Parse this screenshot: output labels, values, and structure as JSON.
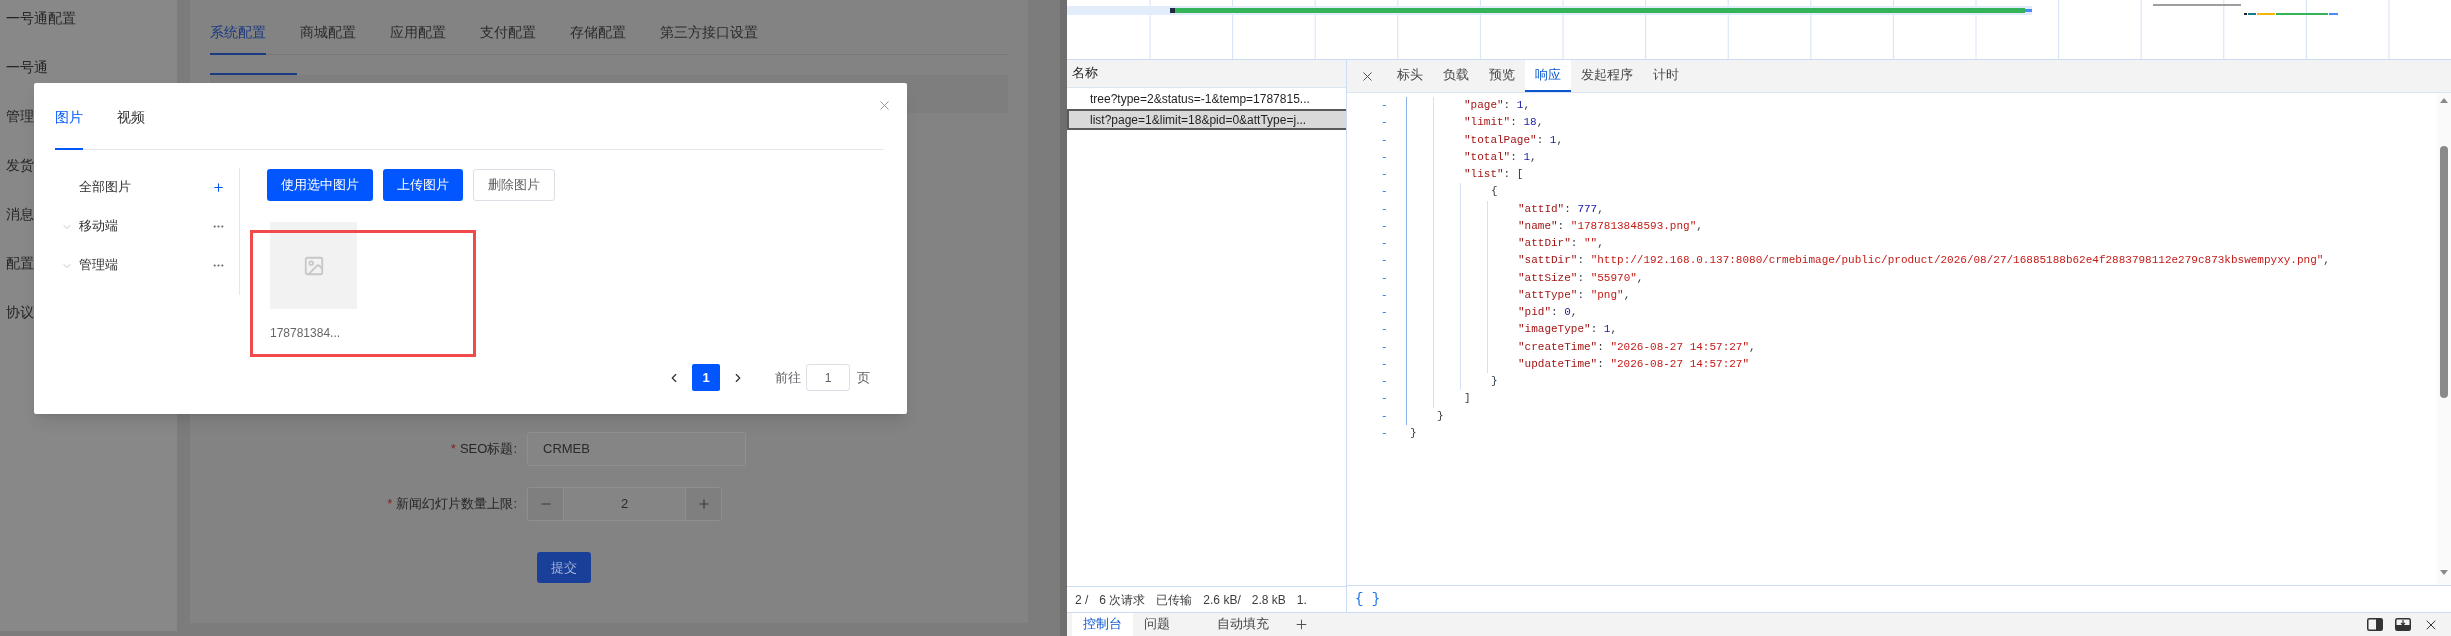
{
  "app": {
    "sidebar": [
      {
        "label": "一号通配置"
      },
      {
        "label": "一号通"
      },
      {
        "label": "管理"
      },
      {
        "label": "发货"
      },
      {
        "label": "消息"
      },
      {
        "label": "配置"
      },
      {
        "label": "协议"
      }
    ],
    "tabs": [
      {
        "label": "系统配置",
        "selected": true
      },
      {
        "label": "商城配置",
        "selected": false
      },
      {
        "label": "应用配置",
        "selected": false
      },
      {
        "label": "支付配置",
        "selected": false
      },
      {
        "label": "存储配置",
        "selected": false
      },
      {
        "label": "第三方接口设置",
        "selected": false
      }
    ],
    "form": {
      "fields": [
        {
          "kind": "text",
          "mark": "*",
          "label": "SEO标题:",
          "value": "CRMEB"
        },
        {
          "kind": "stepper",
          "mark": "*",
          "label": "新闻幻灯片数量上限:",
          "value": "2"
        }
      ],
      "submit": "提交"
    }
  },
  "modal": {
    "tabs": [
      {
        "label": "图片",
        "selected": true
      },
      {
        "label": "视频",
        "selected": false
      }
    ],
    "folders": [
      {
        "kind": "root",
        "label": "全部图片"
      },
      {
        "kind": "group",
        "label": "移动端"
      },
      {
        "kind": "group",
        "label": "管理端"
      }
    ],
    "buttons": [
      {
        "kind": "primary",
        "label": "使用选中图片"
      },
      {
        "kind": "primary",
        "label": "上传图片"
      },
      {
        "kind": "plain",
        "label": "删除图片"
      }
    ],
    "images": [
      {
        "name": "178781384...",
        "highlighted": true
      }
    ],
    "pagination": {
      "pages": [
        {
          "label": "1",
          "selected": true
        }
      ],
      "goto_label": "前往",
      "goto_value": "1",
      "suffix": "页"
    }
  },
  "devtools": {
    "requests": {
      "header": "名称",
      "rows": [
        {
          "name": "tree?type=2&status=-1&temp=1787815...",
          "selected": false
        },
        {
          "name": "list?page=1&limit=18&pid=0&attType=j...",
          "selected": true
        }
      ],
      "status": [
        "2 /",
        "6 次请求",
        "已传输",
        "2.6 kB/",
        "2.8 kB",
        "1."
      ]
    },
    "detail_tabs": [
      {
        "label": "标头",
        "selected": false
      },
      {
        "label": "负载",
        "selected": false
      },
      {
        "label": "预览",
        "selected": false
      },
      {
        "label": "响应",
        "selected": true
      },
      {
        "label": "发起程序",
        "selected": false
      },
      {
        "label": "计时",
        "selected": false
      }
    ],
    "response_lines": [
      {
        "children": [
          {
            "children": [
              {
                "toggle": "-",
                "tokens": [
                  {
                    "text": "\"page\"",
                    "kind": "key"
                  },
                  {
                    "text": ": ",
                    "kind": "punct"
                  },
                  {
                    "text": "1",
                    "kind": "number"
                  },
                  {
                    "text": ",",
                    "kind": "punct"
                  }
                ]
              },
              {
                "toggle": "-",
                "tokens": [
                  {
                    "text": "\"limit\"",
                    "kind": "key"
                  },
                  {
                    "text": ": ",
                    "kind": "punct"
                  },
                  {
                    "text": "18",
                    "kind": "number"
                  },
                  {
                    "text": ",",
                    "kind": "punct"
                  }
                ]
              },
              {
                "toggle": "-",
                "tokens": [
                  {
                    "text": "\"totalPage\"",
                    "kind": "key"
                  },
                  {
                    "text": ": ",
                    "kind": "punct"
                  },
                  {
                    "text": "1",
                    "kind": "number"
                  },
                  {
                    "text": ",",
                    "kind": "punct"
                  }
                ]
              },
              {
                "toggle": "-",
                "tokens": [
                  {
                    "text": "\"total\"",
                    "kind": "key"
                  },
                  {
                    "text": ": ",
                    "kind": "punct"
                  },
                  {
                    "text": "1",
                    "kind": "number"
                  },
                  {
                    "text": ",",
                    "kind": "punct"
                  }
                ]
              },
              {
                "toggle": "-",
                "tokens": [
                  {
                    "text": "\"list\"",
                    "kind": "key"
                  },
                  {
                    "text": ": [",
                    "kind": "punct"
                  }
                ],
                "children": [
                  {
                    "toggle": "-",
                    "tokens": [
                      {
                        "text": "{",
                        "kind": "punct"
                      }
                    ],
                    "children": [
                      {
                        "toggle": "-",
                        "tokens": [
                          {
                            "text": "\"attId\"",
                            "kind": "key"
                          },
                          {
                            "text": ": ",
                            "kind": "punct"
                          },
                          {
                            "text": "777",
                            "kind": "number"
                          },
                          {
                            "text": ",",
                            "kind": "punct"
                          }
                        ]
                      },
                      {
                        "toggle": "-",
                        "tokens": [
                          {
                            "text": "\"name\"",
                            "kind": "key"
                          },
                          {
                            "text": ": ",
                            "kind": "punct"
                          },
                          {
                            "text": "\"1787813848593.png\"",
                            "kind": "string"
                          },
                          {
                            "text": ",",
                            "kind": "punct"
                          }
                        ]
                      },
                      {
                        "toggle": "-",
                        "tokens": [
                          {
                            "text": "\"attDir\"",
                            "kind": "key"
                          },
                          {
                            "text": ": ",
                            "kind": "punct"
                          },
                          {
                            "text": "\"\"",
                            "kind": "string"
                          },
                          {
                            "text": ",",
                            "kind": "punct"
                          }
                        ]
                      },
                      {
                        "toggle": "-",
                        "tokens": [
                          {
                            "text": "\"sattDir\"",
                            "kind": "key"
                          },
                          {
                            "text": ": ",
                            "kind": "punct"
                          },
                          {
                            "text": "\"http://192.168.0.137:8080/crmebimage/public/product/2026/08/27/16885188b62e4f2883798112e279c873kbswempyxy.png\"",
                            "kind": "string"
                          },
                          {
                            "text": ",",
                            "kind": "punct"
                          }
                        ]
                      },
                      {
                        "toggle": "-",
                        "tokens": [
                          {
                            "text": "\"attSize\"",
                            "kind": "key"
                          },
                          {
                            "text": ": ",
                            "kind": "punct"
                          },
                          {
                            "text": "\"55970\"",
                            "kind": "string"
                          },
                          {
                            "text": ",",
                            "kind": "punct"
                          }
                        ]
                      },
                      {
                        "toggle": "-",
                        "tokens": [
                          {
                            "text": "\"attType\"",
                            "kind": "key"
                          },
                          {
                            "text": ": ",
                            "kind": "punct"
                          },
                          {
                            "text": "\"png\"",
                            "kind": "string"
                          },
                          {
                            "text": ",",
                            "kind": "punct"
                          }
                        ]
                      },
                      {
                        "toggle": "-",
                        "tokens": [
                          {
                            "text": "\"pid\"",
                            "kind": "key"
                          },
                          {
                            "text": ": ",
                            "kind": "punct"
                          },
                          {
                            "text": "0",
                            "kind": "number"
                          },
                          {
                            "text": ",",
                            "kind": "punct"
                          }
                        ]
                      },
                      {
                        "toggle": "-",
                        "tokens": [
                          {
                            "text": "\"imageType\"",
                            "kind": "key"
                          },
                          {
                            "text": ": ",
                            "kind": "punct"
                          },
                          {
                            "text": "1",
                            "kind": "number"
                          },
                          {
                            "text": ",",
                            "kind": "punct"
                          }
                        ]
                      },
                      {
                        "toggle": "-",
                        "tokens": [
                          {
                            "text": "\"createTime\"",
                            "kind": "key"
                          },
                          {
                            "text": ": ",
                            "kind": "punct"
                          },
                          {
                            "text": "\"2026-08-27 14:57:27\"",
                            "kind": "string"
                          },
                          {
                            "text": ",",
                            "kind": "punct"
                          }
                        ]
                      },
                      {
                        "toggle": "-",
                        "tokens": [
                          {
                            "text": "\"updateTime\"",
                            "kind": "key"
                          },
                          {
                            "text": ": ",
                            "kind": "punct"
                          },
                          {
                            "text": "\"2026-08-27 14:57:27\"",
                            "kind": "string"
                          }
                        ]
                      }
                    ]
                  },
                  {
                    "toggle": "-",
                    "tokens": [
                      {
                        "text": "}",
                        "kind": "punct"
                      }
                    ]
                  }
                ]
              },
              {
                "toggle": "-",
                "tokens": [
                  {
                    "text": "]",
                    "kind": "punct"
                  }
                ]
              }
            ]
          },
          {
            "toggle": "-",
            "tokens": [
              {
                "text": "}",
                "kind": "punct"
              }
            ]
          }
        ]
      },
      {
        "toggle": "-",
        "tokens": [
          {
            "text": "}",
            "kind": "punct"
          }
        ]
      }
    ],
    "format_button": "{ }",
    "drawer_tabs": [
      {
        "label": "控制台",
        "selected": true
      },
      {
        "label": "问题",
        "selected": false
      },
      {
        "label": "自动填充",
        "selected": false
      }
    ]
  }
}
